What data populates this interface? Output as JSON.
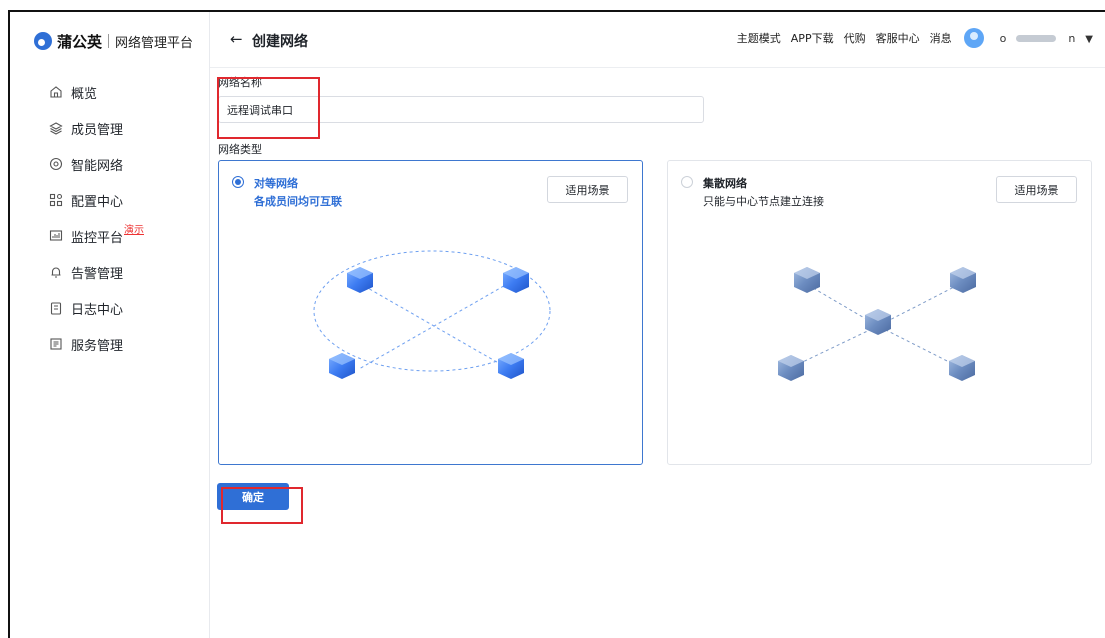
{
  "app": {
    "logo_text": "蒲公英",
    "logo_subtitle": "网络管理平台"
  },
  "sidebar": {
    "items": [
      {
        "label": "概览",
        "icon": "home-icon"
      },
      {
        "label": "成员管理",
        "icon": "layers-icon"
      },
      {
        "label": "智能网络",
        "icon": "network-circle-icon"
      },
      {
        "label": "配置中心",
        "icon": "grid-icon"
      },
      {
        "label": "监控平台",
        "icon": "monitor-icon",
        "tag": "演示"
      },
      {
        "label": "告警管理",
        "icon": "bell-icon"
      },
      {
        "label": "日志中心",
        "icon": "clipboard-icon"
      },
      {
        "label": "服务管理",
        "icon": "list-doc-icon"
      }
    ]
  },
  "header": {
    "back_glyph": "←",
    "title": "创建网络",
    "links": [
      "主题模式",
      "APP下载",
      "代购",
      "客服中心",
      "消息"
    ],
    "user_prefix": "o",
    "user_suffix": "n"
  },
  "form": {
    "name_label": "网络名称",
    "name_value": "远程调试串口",
    "type_label": "网络类型",
    "options": [
      {
        "title": "对等网络",
        "desc": "各成员间均可互联",
        "button": "适用场景",
        "selected": true
      },
      {
        "title": "集散网络",
        "desc": "只能与中心节点建立连接",
        "button": "适用场景",
        "selected": false
      }
    ],
    "confirm_label": "确定"
  },
  "colors": {
    "accent": "#2f6fd6",
    "highlight": "#e0282e",
    "node_light": "#5a8ef0",
    "node_muted": "#7d97be"
  }
}
